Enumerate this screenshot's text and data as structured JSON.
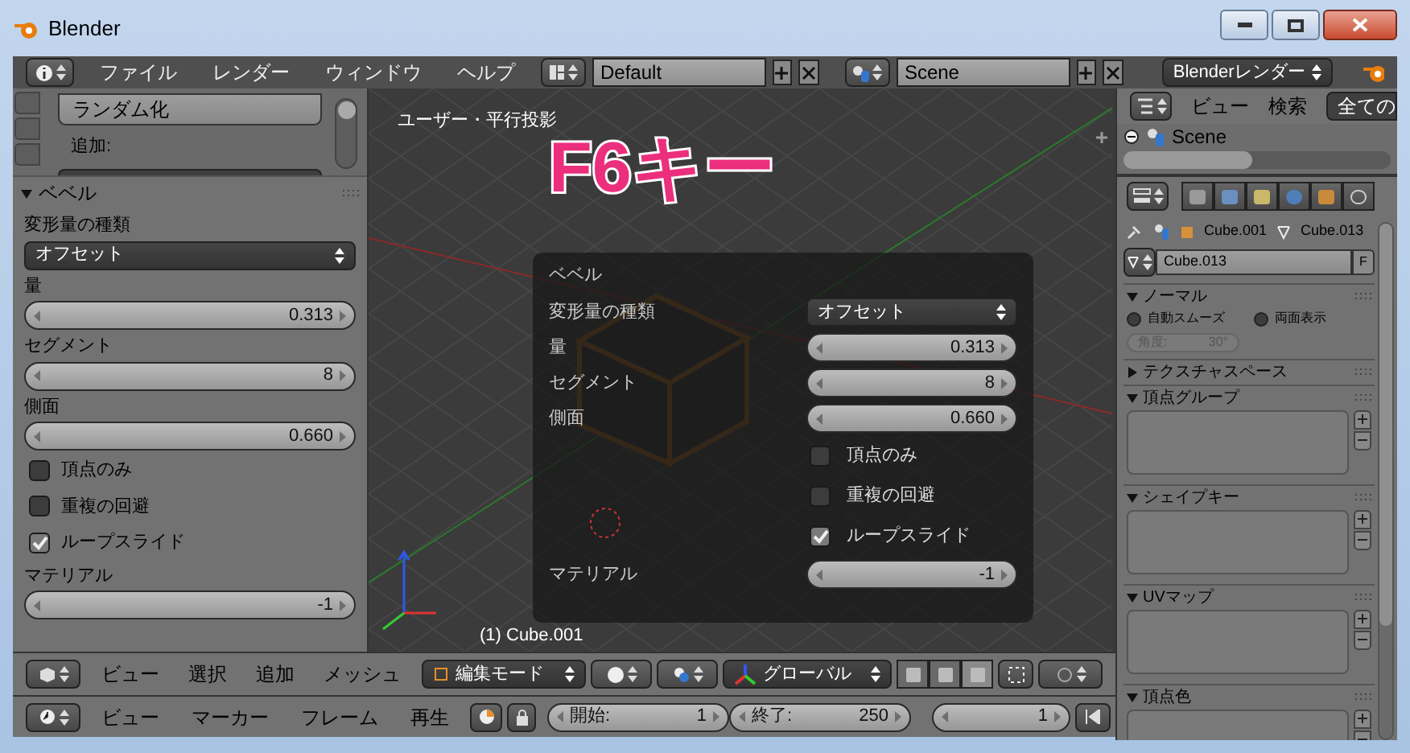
{
  "window": {
    "title": "Blender"
  },
  "menu_bar": {
    "menus": [
      "ファイル",
      "レンダー",
      "ウィンドウ",
      "ヘルプ"
    ],
    "layout": "Default",
    "scene": "Scene",
    "render_engine": "Blenderレンダー"
  },
  "tool_shelf": {
    "randomize_button": "ランダム化",
    "add_label": "追加:",
    "panel": {
      "title": "ベベル",
      "expanded": true,
      "fields": [
        {
          "kind": "dropdown",
          "label": "変形量の種類",
          "value": "オフセット"
        },
        {
          "kind": "number",
          "label": "量",
          "value": "0.313"
        },
        {
          "kind": "number",
          "label": "セグメント",
          "value": "8"
        },
        {
          "kind": "number",
          "label": "側面",
          "value": "0.660"
        },
        {
          "kind": "checkbox",
          "label": "頂点のみ",
          "checked": false
        },
        {
          "kind": "checkbox",
          "label": "重複の回避",
          "checked": false
        },
        {
          "kind": "checkbox",
          "label": "ループスライド",
          "checked": true
        },
        {
          "kind": "number",
          "label": "マテリアル",
          "value": "-1"
        }
      ]
    }
  },
  "viewport": {
    "view_label": "ユーザー・平行投影",
    "overlay_text": "F6キー",
    "object_label": "(1) Cube.001",
    "redo_panel": {
      "title": "ベベル",
      "fields": [
        {
          "kind": "dropdown",
          "label": "変形量の種類",
          "value": "オフセット"
        },
        {
          "kind": "number",
          "label": "量",
          "value": "0.313"
        },
        {
          "kind": "number",
          "label": "セグメント",
          "value": "8"
        },
        {
          "kind": "number",
          "label": "側面",
          "value": "0.660"
        },
        {
          "kind": "checkbox",
          "label": "頂点のみ",
          "checked": false
        },
        {
          "kind": "checkbox",
          "label": "重複の回避",
          "checked": false
        },
        {
          "kind": "checkbox",
          "label": "ループスライド",
          "checked": true
        },
        {
          "kind": "number",
          "label": "マテリアル",
          "value": "-1"
        }
      ]
    }
  },
  "outliner": {
    "menus": [
      "ビュー",
      "検索"
    ],
    "filter": "全ての",
    "tree": [
      {
        "label": "Scene",
        "expanded": true
      }
    ]
  },
  "properties": {
    "breadcrumb": [
      "Cube.001",
      "Cube.013"
    ],
    "mesh_name": "Cube.013",
    "fake_user": "F",
    "panels": [
      {
        "kind": "normals",
        "title": "ノーマル",
        "expanded": true,
        "options": [
          {
            "label": "自動スムーズ",
            "checked": false
          },
          {
            "label": "両面表示",
            "checked": false
          }
        ],
        "angle": {
          "label": "角度:",
          "value": "30°",
          "disabled": true
        }
      },
      {
        "kind": "plain",
        "title": "テクスチャスペース",
        "expanded": false
      },
      {
        "kind": "list",
        "title": "頂点グループ",
        "expanded": true
      },
      {
        "kind": "list",
        "title": "シェイプキー",
        "expanded": true
      },
      {
        "kind": "list",
        "title": "UVマップ",
        "expanded": true
      },
      {
        "kind": "list",
        "title": "頂点色",
        "expanded": true
      }
    ]
  },
  "view3d_header": {
    "menus": [
      "ビュー",
      "選択",
      "追加",
      "メッシュ"
    ],
    "mode": "編集モード",
    "orientation": "グローバル"
  },
  "timeline_header": {
    "menus": [
      "ビュー",
      "マーカー",
      "フレーム",
      "再生"
    ],
    "start": {
      "label": "開始:",
      "value": "1"
    },
    "end": {
      "label": "終了:",
      "value": "250"
    },
    "current": "1"
  }
}
